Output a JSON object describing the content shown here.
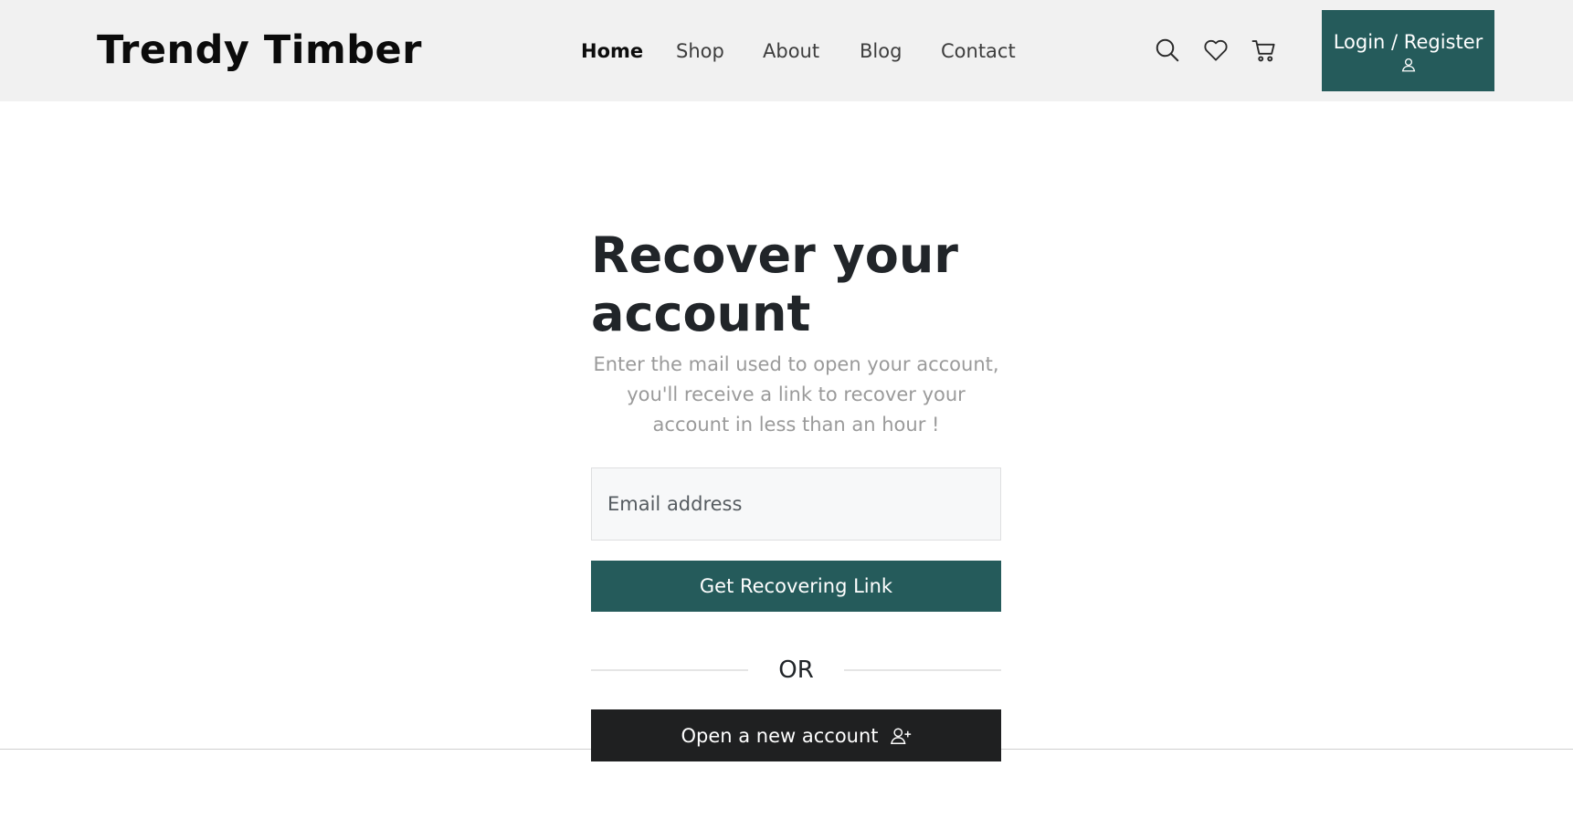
{
  "header": {
    "brand": "Trendy Timber",
    "nav": [
      {
        "label": "Home",
        "active": true
      },
      {
        "label": "Shop",
        "active": false
      },
      {
        "label": "About",
        "active": false
      },
      {
        "label": "Blog",
        "active": false
      },
      {
        "label": "Contact",
        "active": false
      }
    ],
    "icons": [
      "search-icon",
      "heart-icon",
      "cart-icon"
    ],
    "login_label": "Login / Register",
    "login_icon": "user-icon"
  },
  "main": {
    "title": "Recover your account",
    "description": "Enter the mail used to open your account, you'll receive a link to recover your account in less than an hour !",
    "email_placeholder": "Email address",
    "email_value": "",
    "recover_button": "Get Recovering Link",
    "divider_text": "OR",
    "new_account_button": "Open a new account",
    "new_account_icon": "user-plus-icon"
  },
  "colors": {
    "accent": "#255b5b",
    "dark_button": "#1f2021",
    "header_bg": "#f1f1f1",
    "muted_text": "#9a9a9a"
  }
}
